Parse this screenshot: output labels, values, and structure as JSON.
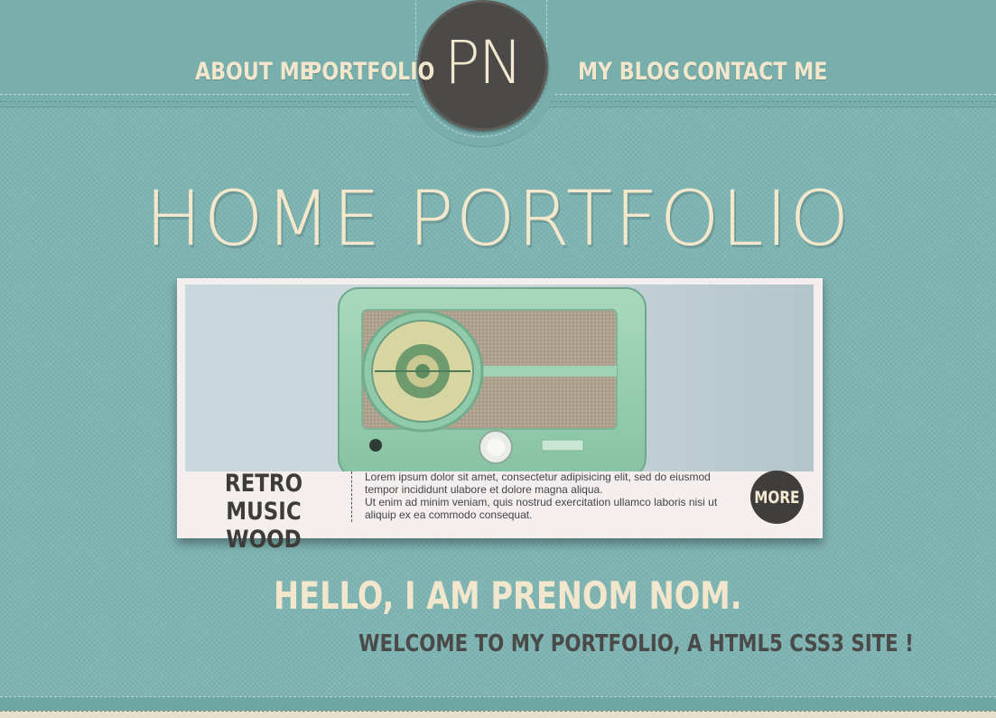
{
  "logo": {
    "text": "PN"
  },
  "nav": {
    "items": [
      {
        "label": "ABOUT ME"
      },
      {
        "label": "PORTFOLIO"
      },
      {
        "label": "MY BLOG"
      },
      {
        "label": "CONTACT ME"
      }
    ]
  },
  "hero": {
    "title": "HOME PORTFOLIO"
  },
  "featured": {
    "image_subject": "retro-radio-photo",
    "title_line1": "RETRO MUSIC",
    "title_line2": "WOOD",
    "text_1": "Lorem ipsum dolor sit amet, consectetur adipisicing elit, sed do eiusmod tempor incididunt ulabore et dolore magna aliqua.",
    "text_2": "Ut enim ad minim veniam, quis nostrud exercitation ullamco laboris nisi ut aliquip ex ea commodo consequat.",
    "more_label": "MORE"
  },
  "intro": {
    "hello": "HELLO, I AM PRENOM NOM.",
    "welcome": "WELCOME TO MY PORTFOLIO, A HTML5 CSS3 SITE !"
  },
  "colors": {
    "background": "#7fb6b4",
    "cream": "#f3e8cc",
    "dark": "#4b4a48"
  }
}
